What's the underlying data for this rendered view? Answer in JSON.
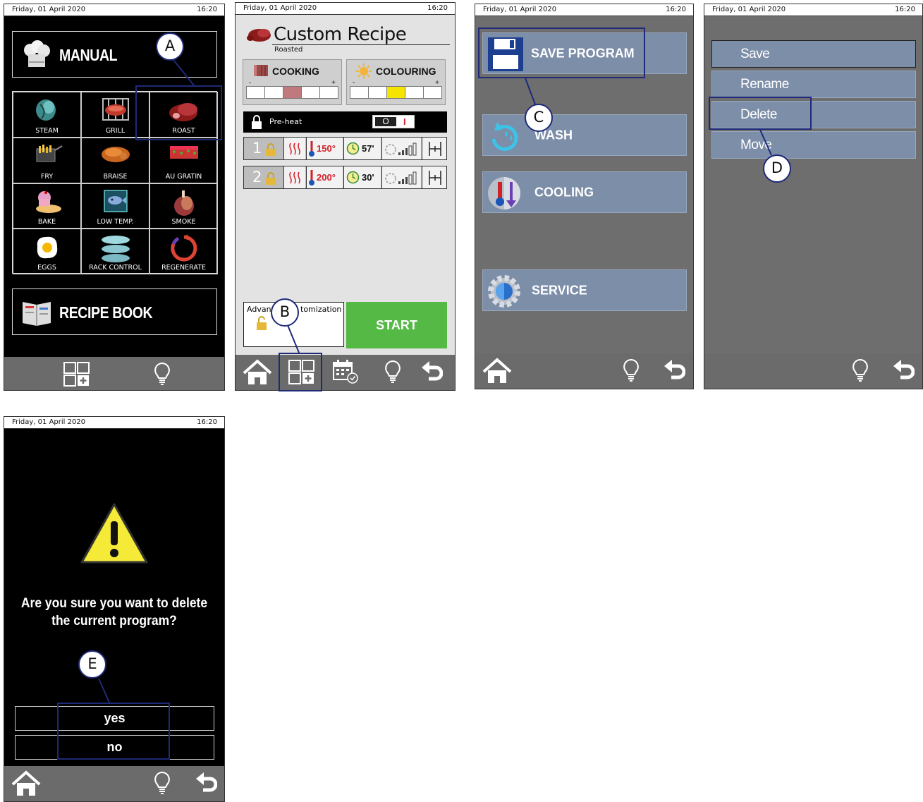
{
  "status": {
    "date": "Friday, 01 April 2020",
    "time": "16:20"
  },
  "screen1": {
    "manual_label": "MANUAL",
    "recipe_book_label": "RECIPE BOOK",
    "modes": [
      "STEAM",
      "GRILL",
      "ROAST",
      "FRY",
      "BRAISE",
      "AU GRATIN",
      "BAKE",
      "LOW TEMP.",
      "SMOKE",
      "EGGS",
      "RACK CONTROL",
      "REGENERATE"
    ]
  },
  "screen2": {
    "title": "Custom Recipe",
    "subtitle": "Roasted",
    "cooking_label": "COOKING",
    "colouring_label": "COLOURING",
    "minus": "-",
    "plus": "+",
    "preheat_label": "Pre-heat",
    "toggle_off": "O",
    "toggle_on": "I",
    "phases": [
      {
        "num": "1",
        "temp": "150°",
        "time": "57'"
      },
      {
        "num": "2",
        "temp": "200°",
        "time": "30'"
      }
    ],
    "advanced_label_left": "Advan",
    "advanced_label_right": "tomization",
    "start_label": "START"
  },
  "screen3": {
    "save_program": "SAVE PROGRAM",
    "wash": "WASH",
    "cooling": "COOLING",
    "service": "SERVICE"
  },
  "screen4": {
    "items": [
      "Save",
      "Rename",
      "Delete",
      "Move"
    ]
  },
  "screen5": {
    "question_line1": "Are you sure you want to delete",
    "question_line2": "the current program?",
    "yes": "yes",
    "no": "no"
  },
  "callouts": [
    "A",
    "B",
    "C",
    "D",
    "E"
  ],
  "colors": {
    "highlight": "#1e2a78",
    "start_green": "#55b945",
    "menu_blue": "#7c8ea8",
    "temp_red": "#d0202a",
    "colouring_yellow": "#f5e400",
    "cooking_pink": "#c07a7e"
  }
}
